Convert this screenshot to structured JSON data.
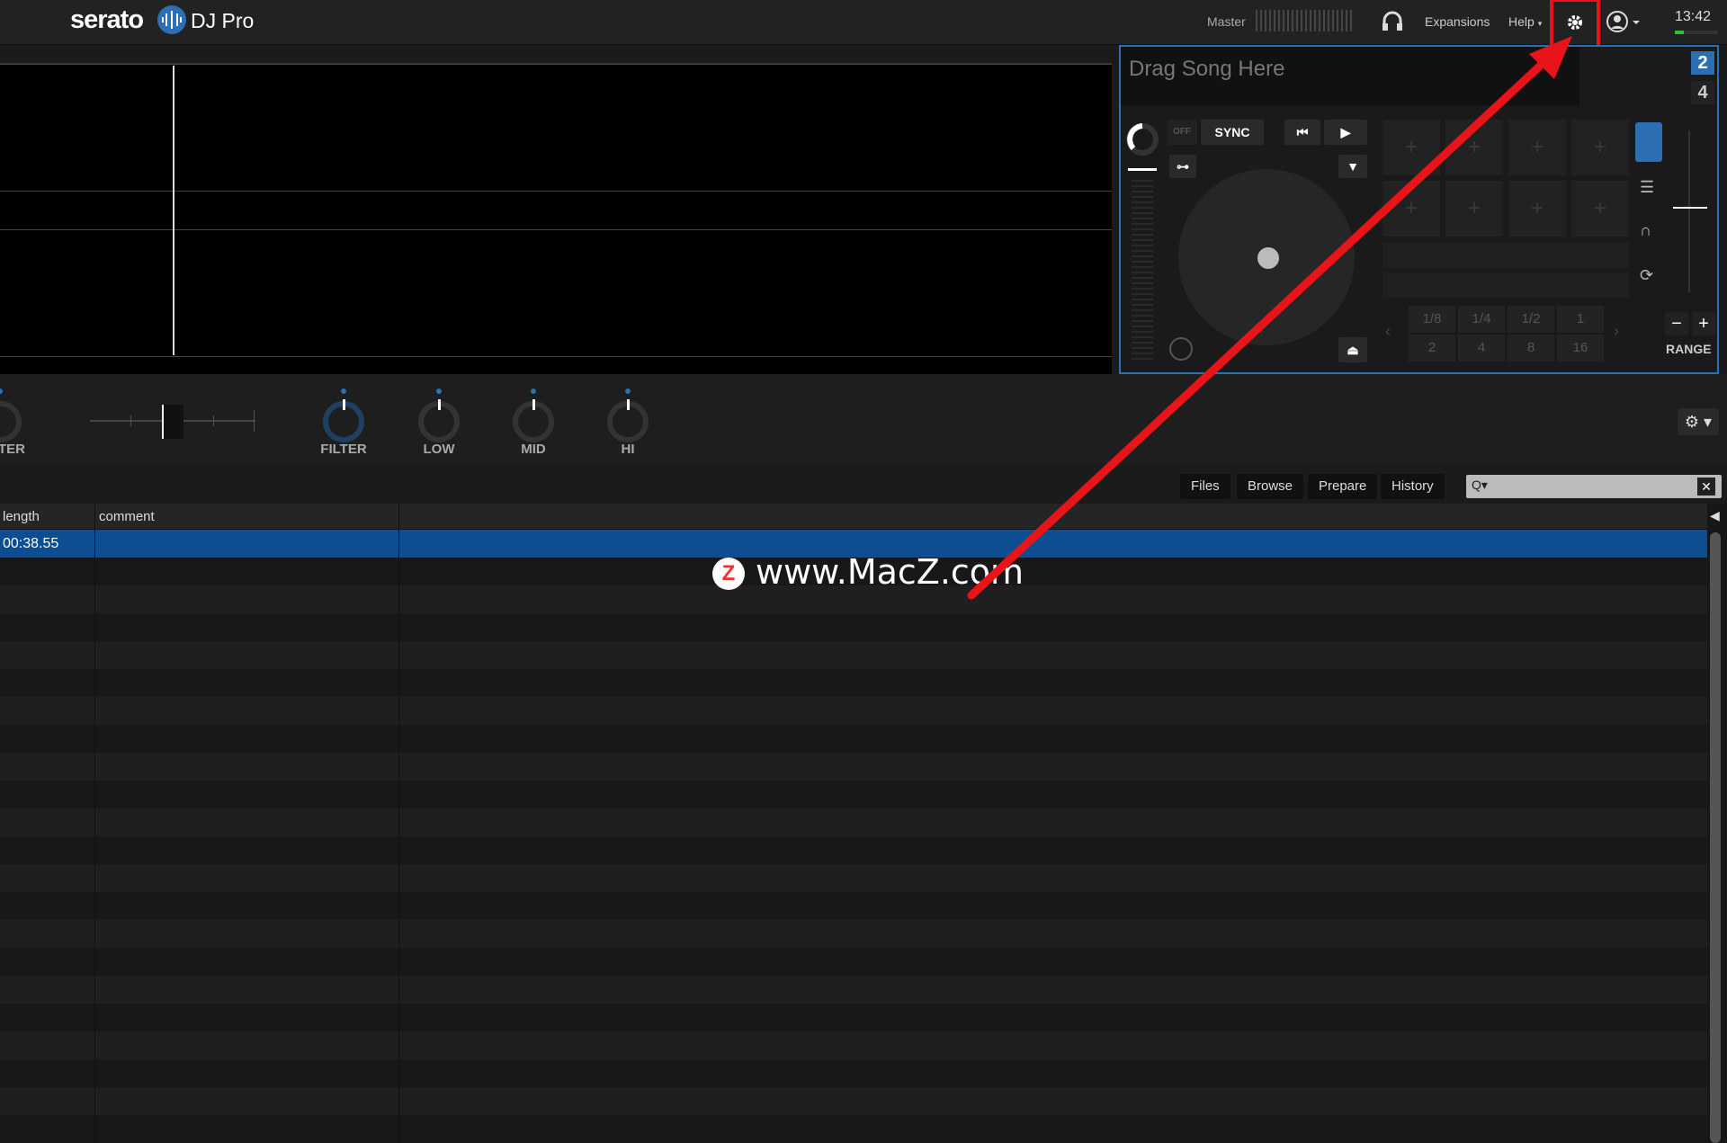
{
  "app": {
    "logo_word": "serato",
    "logo_pro": "DJ Pro"
  },
  "topbar": {
    "master_label": "Master",
    "expansions_label": "Expansions",
    "help_label": "Help",
    "clock": "13:42"
  },
  "deck": {
    "title_placeholder": "Drag Song Here",
    "deck_active": "2",
    "deck_other": "4",
    "off_label": "OFF",
    "sync_label": "SYNC",
    "range_label": "RANGE",
    "pitch_minus": "−",
    "pitch_plus": "+",
    "beat_jumps_top": [
      "1/8",
      "1/4",
      "1/2",
      "1"
    ],
    "beat_jumps_bottom": [
      "2",
      "4",
      "8",
      "16"
    ],
    "pad_glyph": "+"
  },
  "fx": {
    "knobs": [
      {
        "label": "TER"
      },
      {
        "label": "FILTER"
      },
      {
        "label": "LOW"
      },
      {
        "label": "MID"
      },
      {
        "label": "HI"
      }
    ],
    "gear_label": "⚙ ▾"
  },
  "library": {
    "tabs": [
      "Files",
      "Browse",
      "Prepare",
      "History"
    ],
    "search_icon": "Q▾",
    "search_clear": "✕",
    "columns": [
      "length",
      "comment"
    ],
    "rows": [
      {
        "length": "00:38.55",
        "comment": ""
      }
    ]
  },
  "watermark": {
    "logo": "Z",
    "text": "www.MacZ.com"
  },
  "colors": {
    "accent": "#2c6fb3",
    "selection": "#0d4d91",
    "highlight": "#e8141a"
  },
  "icons": [
    "serato-logo-icon",
    "headphones-icon",
    "gear-icon",
    "user-icon",
    "cue-icon",
    "play-icon",
    "eject-icon",
    "slip-icon",
    "search-icon",
    "close-icon"
  ]
}
